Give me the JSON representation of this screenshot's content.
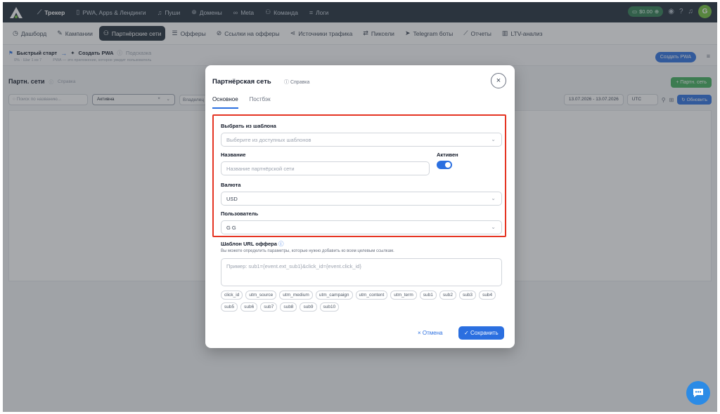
{
  "topnav": {
    "items": [
      {
        "label": "Трекер",
        "icon": "trend-icon"
      },
      {
        "label": "PWA, Apps & Лендинги",
        "icon": "phone-icon"
      },
      {
        "label": "Пуши",
        "icon": "bell-icon"
      },
      {
        "label": "Домены",
        "icon": "globe-icon"
      },
      {
        "label": "Meta",
        "icon": "meta-icon"
      },
      {
        "label": "Команда",
        "icon": "team-icon"
      },
      {
        "label": "Логи",
        "icon": "list-icon"
      }
    ],
    "balance": "$0.00",
    "avatar": "G"
  },
  "subnav": {
    "items": [
      {
        "label": "Дашборд",
        "icon": "clock-icon"
      },
      {
        "label": "Кампании",
        "icon": "edit-icon"
      },
      {
        "label": "Партнёрские сети",
        "icon": "team-icon"
      },
      {
        "label": "Офферы",
        "icon": "stack-icon"
      },
      {
        "label": "Ссылки на офферы",
        "icon": "link-icon"
      },
      {
        "label": "Источники трафика",
        "icon": "share-icon"
      },
      {
        "label": "Пиксели",
        "icon": "swap-icon"
      },
      {
        "label": "Telegram боты",
        "icon": "telegram-icon"
      },
      {
        "label": "Отчеты",
        "icon": "chart-icon"
      },
      {
        "label": "LTV-анализ",
        "icon": "bar-icon"
      }
    ]
  },
  "quickstart": {
    "title": "Быстрый старт",
    "step": "Создать PWA",
    "help": "Подсказка",
    "progress": "0% · Шаг 1 из 7",
    "desc": "PWA — это приложение, которое увидит пользователь",
    "create_button": "Создать PWA"
  },
  "page": {
    "title": "Партн. сети",
    "help": "Справка",
    "add_button": "+ Партн. сеть",
    "search_placeholder": "Поиск по названию...",
    "status_value": "Активна",
    "owner_label": "Владелец",
    "date_range": "13.07.2026 - 13.07.2026",
    "timezone": "UTC",
    "refresh_button": "Обновить"
  },
  "modal": {
    "title": "Партнёрская сеть",
    "help": "Справка",
    "tabs": [
      "Основное",
      "Постбэк"
    ],
    "template_label": "Выбрать из шаблона",
    "template_placeholder": "Выберите из доступных шаблонов",
    "name_label": "Название",
    "name_placeholder": "Название партнёрской сети",
    "active_label": "Активен",
    "active": true,
    "currency_label": "Валюта",
    "currency_value": "USD",
    "user_label": "Пользователь",
    "user_value": "G G",
    "url_template_label": "Шаблон URL оффера",
    "url_template_hint": "Вы можете определить параметры, которые нужно добавить ко всем целевым ссылкам.",
    "url_template_placeholder": "Пример: sub1={event.ext_sub1}&click_id={event.click_id}",
    "chips": [
      "click_id",
      "utm_source",
      "utm_medium",
      "utm_campaign",
      "utm_content",
      "utm_term",
      "sub1",
      "sub2",
      "sub3",
      "sub4",
      "sub5",
      "sub6",
      "sub7",
      "sub8",
      "sub9",
      "sub10"
    ],
    "cancel_button": "Отмена",
    "save_button": "Сохранить"
  },
  "colors": {
    "primary": "#2b6fe0",
    "highlight": "#e53422",
    "nav_bg": "#1e2b38",
    "success": "#3fae5a"
  }
}
